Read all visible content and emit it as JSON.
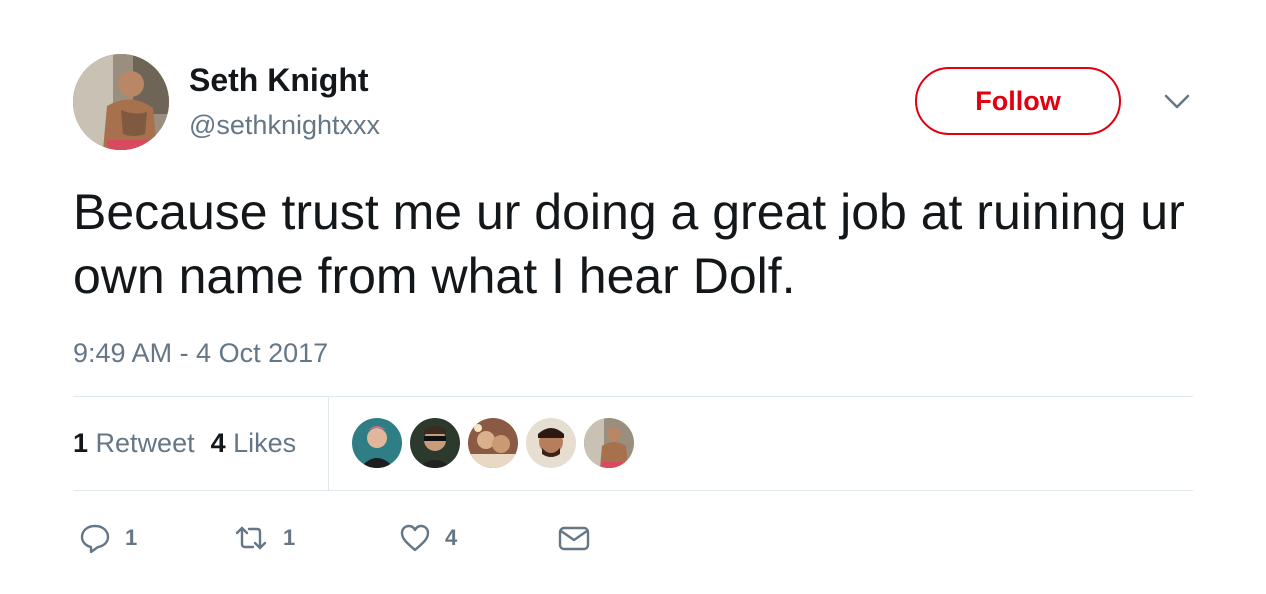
{
  "author": {
    "display_name": "Seth Knight",
    "handle": "@sethknightxxx"
  },
  "follow_button": {
    "label": "Follow",
    "accent_color": "#e0000f"
  },
  "tweet": {
    "text": "Because trust me ur doing a great job at ruining ur own name from what I hear Dolf.",
    "timestamp": "9:49 AM - 4 Oct 2017"
  },
  "stats": {
    "retweets_count": "1",
    "retweets_label": "Retweet",
    "likes_count": "4",
    "likes_label": "Likes"
  },
  "actions": {
    "reply_count": "1",
    "retweet_count": "1",
    "like_count": "4"
  },
  "icons": {
    "caret": "chevron-down-icon",
    "reply": "reply-icon",
    "retweet": "retweet-icon",
    "like": "heart-icon",
    "message": "envelope-icon"
  }
}
